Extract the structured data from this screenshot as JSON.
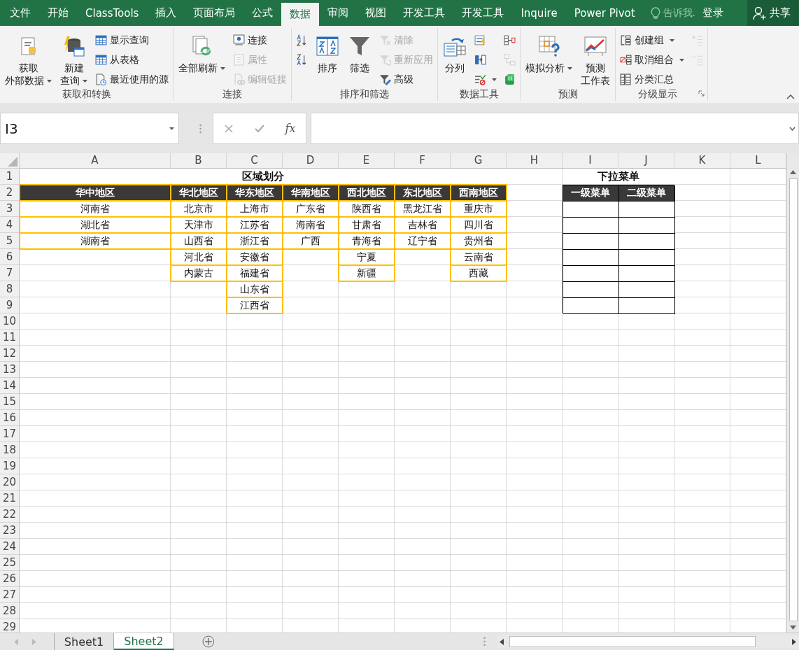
{
  "ribbon_tabs": [
    {
      "label": "文件",
      "selected": false
    },
    {
      "label": "开始",
      "selected": false
    },
    {
      "label": "ClassTools",
      "selected": false
    },
    {
      "label": "插入",
      "selected": false
    },
    {
      "label": "页面布局",
      "selected": false
    },
    {
      "label": "公式",
      "selected": false
    },
    {
      "label": "数据",
      "selected": true
    },
    {
      "label": "审阅",
      "selected": false
    },
    {
      "label": "视图",
      "selected": false
    },
    {
      "label": "开发工具",
      "selected": false
    },
    {
      "label": "开发工具",
      "selected": false
    },
    {
      "label": "Inquire",
      "selected": false
    },
    {
      "label": "Power Pivot",
      "selected": false
    }
  ],
  "tell_me": "告诉我.",
  "sign_in": "登录",
  "share": "共享",
  "ribbon_groups": [
    {
      "label": "获取和转换",
      "items": [
        {
          "kind": "large",
          "lines": [
            "获取",
            "外部数据"
          ],
          "dropdown": true,
          "disabled": false
        },
        {
          "kind": "large",
          "lines": [
            "新建",
            "查询"
          ],
          "dropdown": true,
          "disabled": false
        },
        {
          "kind": "small",
          "label": "显示查询",
          "dropdown": false,
          "disabled": false
        },
        {
          "kind": "small",
          "label": "从表格",
          "dropdown": false,
          "disabled": false
        },
        {
          "kind": "small",
          "label": "最近使用的源",
          "dropdown": false,
          "disabled": false
        }
      ]
    },
    {
      "label": "连接",
      "items": [
        {
          "kind": "large",
          "lines": [
            "全部刷新"
          ],
          "dropdown": true,
          "disabled": false
        },
        {
          "kind": "small",
          "label": "连接",
          "dropdown": false,
          "disabled": false
        },
        {
          "kind": "small",
          "label": "属性",
          "dropdown": false,
          "disabled": true
        },
        {
          "kind": "small",
          "label": "编辑链接",
          "dropdown": false,
          "disabled": true
        }
      ]
    },
    {
      "label": "排序和筛选",
      "items": [
        {
          "kind": "icon",
          "dropdown": false,
          "disabled": false
        },
        {
          "kind": "icon",
          "dropdown": false,
          "disabled": false
        },
        {
          "kind": "large",
          "lines": [
            "排序"
          ],
          "dropdown": false,
          "disabled": false
        },
        {
          "kind": "large",
          "lines": [
            "筛选"
          ],
          "dropdown": false,
          "disabled": false
        },
        {
          "kind": "small",
          "label": "清除",
          "dropdown": false,
          "disabled": true
        },
        {
          "kind": "small",
          "label": "重新应用",
          "dropdown": false,
          "disabled": true
        },
        {
          "kind": "small",
          "label": "高级",
          "dropdown": false,
          "disabled": false
        }
      ]
    },
    {
      "label": "数据工具",
      "items": [
        {
          "kind": "large",
          "lines": [
            "分列"
          ],
          "dropdown": false,
          "disabled": false
        },
        {
          "kind": "icon",
          "dropdown": false,
          "disabled": false
        },
        {
          "kind": "icon",
          "dropdown": false,
          "disabled": false
        },
        {
          "kind": "icon",
          "dropdown": true,
          "disabled": false
        },
        {
          "kind": "icon",
          "dropdown": false,
          "disabled": false
        },
        {
          "kind": "icon",
          "dropdown": false,
          "disabled": true
        },
        {
          "kind": "icon",
          "dropdown": false,
          "disabled": false
        }
      ]
    },
    {
      "label": "预测",
      "items": [
        {
          "kind": "large",
          "lines": [
            "模拟分析"
          ],
          "dropdown": true,
          "disabled": false
        },
        {
          "kind": "large",
          "lines": [
            "预测",
            "工作表"
          ],
          "dropdown": false,
          "disabled": false
        }
      ]
    },
    {
      "label": "分级显示",
      "items": [
        {
          "kind": "small",
          "label": "创建组",
          "dropdown": true,
          "disabled": false
        },
        {
          "kind": "small",
          "label": "取消组合",
          "dropdown": true,
          "disabled": false
        },
        {
          "kind": "small",
          "label": "分类汇总",
          "dropdown": false,
          "disabled": false
        },
        {
          "kind": "icon",
          "dropdown": false,
          "disabled": true
        },
        {
          "kind": "icon",
          "dropdown": false,
          "disabled": true
        }
      ]
    }
  ],
  "name_box": "I3",
  "fx": "fx",
  "columns": [
    "A",
    "B",
    "C",
    "D",
    "E",
    "F",
    "G",
    "H",
    "I",
    "J",
    "K",
    "L"
  ],
  "rows": [
    "1",
    "2",
    "3",
    "4",
    "5",
    "6",
    "7",
    "8",
    "9",
    "10",
    "11",
    "12",
    "13",
    "14",
    "15",
    "16",
    "17",
    "18",
    "19",
    "20",
    "21",
    "22",
    "23",
    "24",
    "25",
    "26",
    "27",
    "28",
    "29"
  ],
  "region_table": {
    "title": "区域划分",
    "regions": [
      {
        "header": "华中地区",
        "cells": [
          "河南省",
          "湖北省",
          "湖南省"
        ]
      },
      {
        "header": "华北地区",
        "cells": [
          "北京市",
          "天津市",
          "山西省",
          "河北省",
          "内蒙古"
        ]
      },
      {
        "header": "华东地区",
        "cells": [
          "上海市",
          "江苏省",
          "浙江省",
          "安徽省",
          "福建省",
          "山东省",
          "江西省"
        ]
      },
      {
        "header": "华南地区",
        "cells": [
          "广东省",
          "海南省",
          "广西"
        ]
      },
      {
        "header": "西北地区",
        "cells": [
          "陕西省",
          "甘肃省",
          "青海省",
          "宁夏",
          "新疆"
        ]
      },
      {
        "header": "东北地区",
        "cells": [
          "黑龙江省",
          "吉林省",
          "辽宁省"
        ]
      },
      {
        "header": "西南地区",
        "cells": [
          "重庆市",
          "四川省",
          "贵州省",
          "云南省",
          "西藏"
        ]
      }
    ]
  },
  "menu_table": {
    "title": "下拉菜单",
    "headers": [
      "一级菜单",
      "二级菜单"
    ]
  },
  "sheets": [
    {
      "label": "Sheet1",
      "selected": false
    },
    {
      "label": "Sheet2",
      "selected": true
    }
  ]
}
